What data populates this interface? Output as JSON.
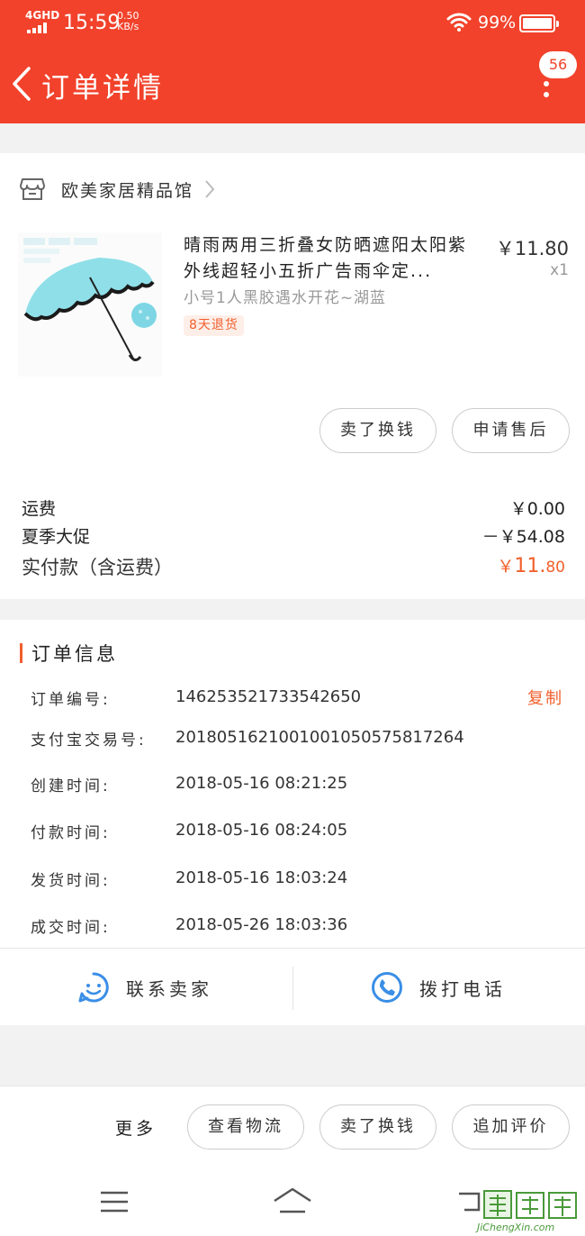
{
  "status_bar": {
    "network": "4GHD",
    "time": "15:59",
    "speed_value": "0.50",
    "speed_unit": "KB/s",
    "battery": "99%"
  },
  "header": {
    "title": "订单详情",
    "badge_count": "56"
  },
  "shop": {
    "name": "欧美家居精品馆"
  },
  "product": {
    "title": "晴雨两用三折叠女防晒遮阳太阳紫外线超轻小五折广告雨伞定...",
    "sku": "小号1人黑胶遇水开花~湖蓝",
    "tag": "8天退货",
    "price": "￥11.80",
    "quantity": "x1"
  },
  "item_actions": {
    "sell_label": "卖了换钱",
    "after_sale_label": "申请售后"
  },
  "fees": {
    "shipping_label": "运费",
    "shipping_value": "￥0.00",
    "promo_label": "夏季大促",
    "promo_value": "－￥54.08",
    "total_label": "实付款（含运费）",
    "total_currency": "￥",
    "total_integer": "11.",
    "total_decimal": "80"
  },
  "order_info": {
    "title": "订单信息",
    "copy_label": "复制",
    "rows": [
      {
        "label": "订单编号:",
        "value": "146253521733542650"
      },
      {
        "label": "支付宝交易号:",
        "value": "2018051621001001050575817264"
      },
      {
        "label": "创建时间:",
        "value": "2018-05-16 08:21:25"
      },
      {
        "label": "付款时间:",
        "value": "2018-05-16 08:24:05"
      },
      {
        "label": "发货时间:",
        "value": "2018-05-16 18:03:24"
      },
      {
        "label": "成交时间:",
        "value": "2018-05-26 18:03:36"
      }
    ]
  },
  "contact": {
    "seller_label": "联系卖家",
    "call_label": "拨打电话"
  },
  "bottom_bar": {
    "more_label": "更多",
    "logistics_label": "查看物流",
    "sell_label": "卖了换钱",
    "review_label": "追加评价"
  },
  "watermark": {
    "text": "JiChengXin.com"
  },
  "colors": {
    "accent": "#f2422b",
    "price_orange": "#f25f2c",
    "icon_blue": "#3a8ee6"
  }
}
